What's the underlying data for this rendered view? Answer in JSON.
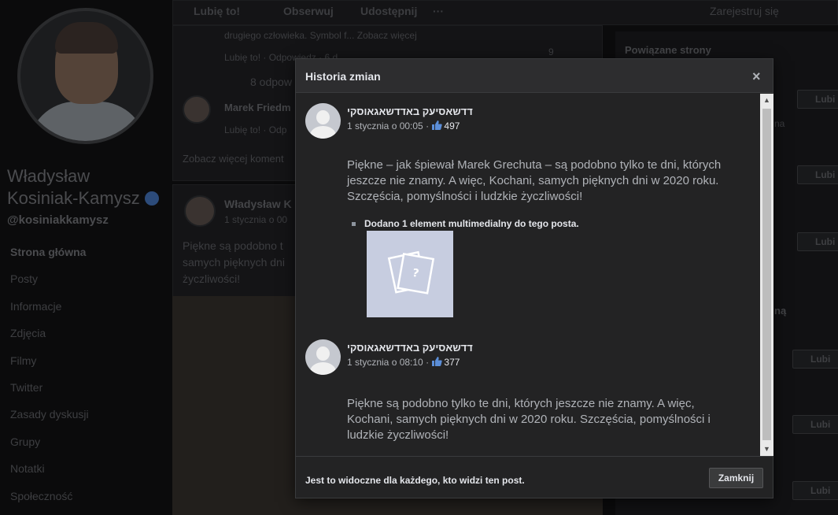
{
  "background": {
    "page_name": "Władysław Kosiniak-Kamysz",
    "page_name_line1": "Władysław",
    "page_name_line2": "Kosiniak-Kamysz",
    "handle": "@kosiniakkamysz",
    "nav": [
      "Strona główna",
      "Posty",
      "Informacje",
      "Zdjęcia",
      "Filmy",
      "Twitter",
      "Zasady dyskusji",
      "Grupy",
      "Notatki",
      "Społeczność"
    ],
    "top_actions": {
      "like": "Lubię to!",
      "follow": "Obserwuj",
      "share": "Udostępnij",
      "more": "···",
      "register": "Zarejestruj się"
    },
    "comment1": {
      "snippet": "drugiego człowieka. Symbol f...  Zobacz więcej",
      "like": "Lubię to!",
      "reply": "Odpowiedz",
      "time": "6 d",
      "reactions": "9",
      "replies": "8 odpow"
    },
    "comment2": {
      "author": "Marek Friedm",
      "like": "Lubię to!",
      "reply": "Odp"
    },
    "see_more_comments": "Zobacz więcej koment",
    "post": {
      "author": "Władysław K",
      "date": "1 stycznia o 00",
      "text_l1": "Piękne są podobno t",
      "text_l2": "samych pięknych dni",
      "text_l3": "życzliwości!"
    },
    "right_col": {
      "related_pages": "Powiązane strony",
      "like_btn": "Lubi",
      "snippet1": "na",
      "snippet2": "ną"
    }
  },
  "modal": {
    "title": "Historia zmian",
    "close_symbol": "×",
    "entries": [
      {
        "author": "דדשאסיעק באדדשאגאוסקי",
        "date": "1 stycznia o 00:05",
        "separator": "·",
        "likes": "497",
        "body": "Piękne – jak śpiewał Marek Grechuta – są podobno tylko te dni, których jeszcze nie znamy. A więc, Kochani, samych pięknych dni w 2020 roku. Szczęścia, pomyślności i ludzkie życzliwości!",
        "media_note": "Dodano 1 element multimedialny do tego posta."
      },
      {
        "author": "דדשאסיעק באדדשאגאוסקי",
        "date": "1 stycznia o 08:10",
        "separator": "·",
        "likes": "377",
        "body": "Piękne są podobno tylko te dni, których jeszcze nie znamy. A więc, Kochani, samych pięknych dni w 2020 roku. Szczęścia, pomyślności i ludzkie życzliwości!"
      }
    ],
    "footer_text": "Jest to widoczne dla każdego, kto widzi ten post.",
    "close_button": "Zamknij"
  },
  "colors": {
    "modal_bg": "#232324",
    "header_bg": "#2d2d2f",
    "like_blue": "#5b8ed8",
    "placeholder_bg": "#c7cde0"
  }
}
